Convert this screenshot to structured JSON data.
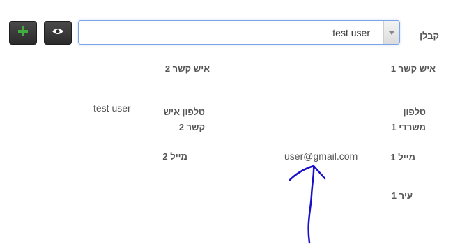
{
  "form": {
    "contractor_label": "קבלן",
    "contractor_select": {
      "value": "test user"
    },
    "contact1_label": "איש קשר 1",
    "contact2_label": "איש קשר 2",
    "office_phone1_label_line1": "טלפון",
    "office_phone1_label_line2": "משרדי 1",
    "contact_phone2_label_line1": "טלפון איש",
    "contact_phone2_label_line2": "קשר 2",
    "contact_phone2_value": "test user",
    "email1_label": "מייל 1",
    "email1_value": "user@gmail.com",
    "email2_label": "מייל 2",
    "city1_label": "עיר 1"
  },
  "toolbar": {
    "add_icon": "plus-icon",
    "view_icon": "eye-icon"
  },
  "annotation": {
    "color": "#1a10c8",
    "icon": "hand-drawn-arrow"
  }
}
